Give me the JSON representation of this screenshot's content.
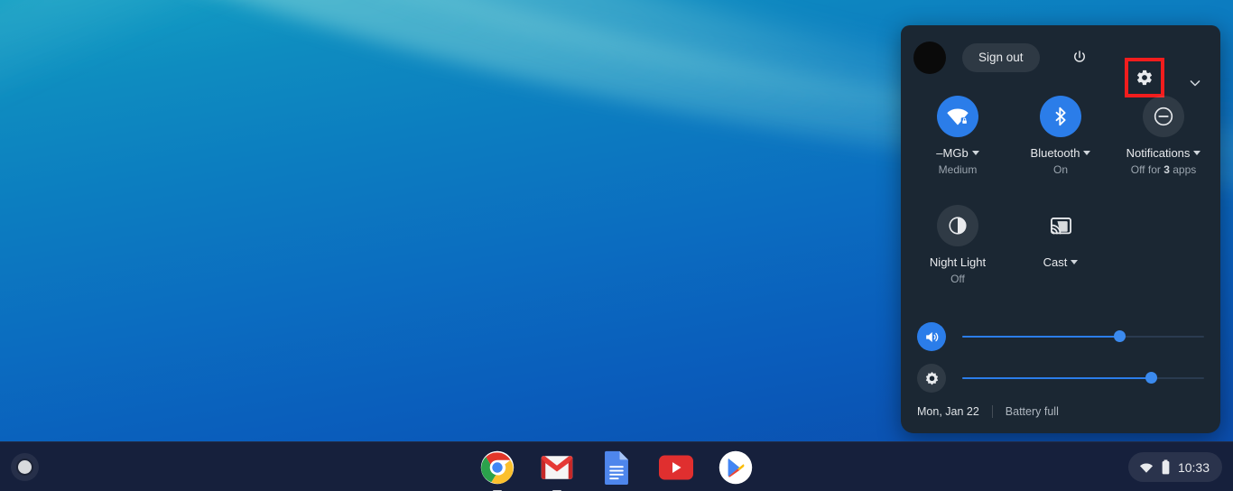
{
  "desktop": {
    "wallpaper_base_color": "#0b6cc0",
    "wallpaper_accent_color": "#19b4cf"
  },
  "quick_settings": {
    "background_color": "#1b2733",
    "accent_color": "#2b7de9",
    "highlight_box_color": "#f21d1d",
    "header": {
      "avatar_name": "user-avatar",
      "sign_out_label": "Sign out",
      "power_icon": "power-icon",
      "settings_icon": "gear-icon",
      "collapse_icon": "chevron-down-icon"
    },
    "tiles": [
      {
        "icon": "wifi-locked-icon",
        "label": "–MGb",
        "sub": "Medium",
        "state": "on",
        "has_caret": true
      },
      {
        "icon": "bluetooth-icon",
        "label": "Bluetooth",
        "sub": "On",
        "state": "on",
        "has_caret": true
      },
      {
        "icon": "do-not-disturb-icon",
        "label": "Notifications",
        "sub_prefix": "Off for ",
        "sub_count": "3",
        "sub_suffix": " apps",
        "state": "off",
        "has_caret": true
      },
      {
        "icon": "night-light-icon",
        "label": "Night Light",
        "sub": "Off",
        "state": "off",
        "has_caret": false
      },
      {
        "icon": "cast-icon",
        "label": "Cast",
        "sub": "",
        "state": "off",
        "has_caret": true
      }
    ],
    "sliders": [
      {
        "icon": "volume-icon",
        "value": 65
      },
      {
        "icon": "brightness-icon",
        "value": 78
      }
    ],
    "footer": {
      "date": "Mon, Jan 22",
      "battery": "Battery full"
    }
  },
  "shelf": {
    "background_color": "#16203c",
    "launcher_icon": "launcher-icon",
    "apps": [
      {
        "name": "chrome",
        "label": "Chrome",
        "running": true
      },
      {
        "name": "gmail",
        "label": "Gmail",
        "running": true
      },
      {
        "name": "docs",
        "label": "Docs",
        "running": false
      },
      {
        "name": "youtube",
        "label": "YouTube",
        "running": false
      },
      {
        "name": "play-store",
        "label": "Play Store",
        "running": false
      }
    ],
    "tray": {
      "wifi_icon": "wifi-icon",
      "battery_icon": "battery-icon",
      "clock": "10:33"
    }
  }
}
